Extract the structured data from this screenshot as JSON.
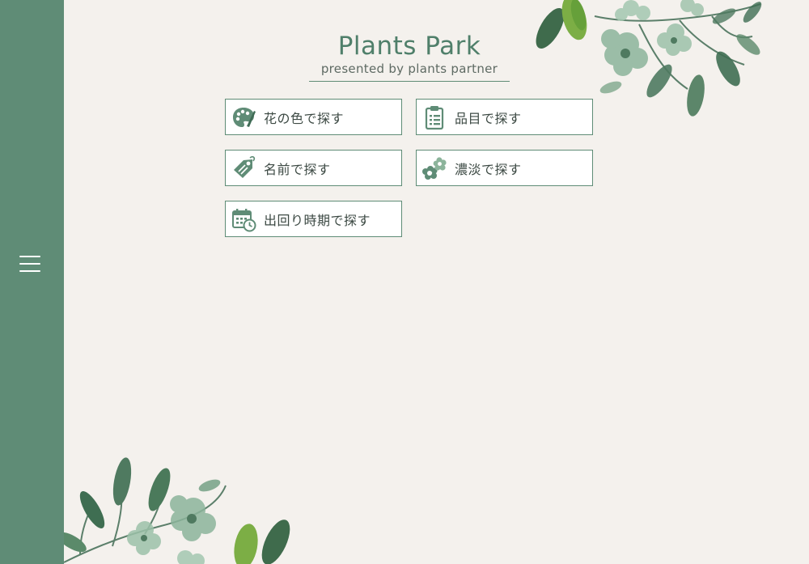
{
  "site": {
    "title": "Plants Park",
    "subtitle": "presented by plants partner"
  },
  "sidebar": {
    "menu_icon": "hamburger-menu-icon"
  },
  "search_buttons": [
    {
      "label": "花の色で探す",
      "icon": "palette-icon"
    },
    {
      "label": "品目で探す",
      "icon": "clipboard-list-icon"
    },
    {
      "label": "名前で探す",
      "icon": "tag-icon"
    },
    {
      "label": "濃淡で探す",
      "icon": "flowers-icon"
    },
    {
      "label": "出回り時期で探す",
      "icon": "calendar-clock-icon"
    }
  ],
  "colors": {
    "accent": "#5f8c76",
    "background": "#f4f1ed",
    "text": "#3d4a44"
  }
}
